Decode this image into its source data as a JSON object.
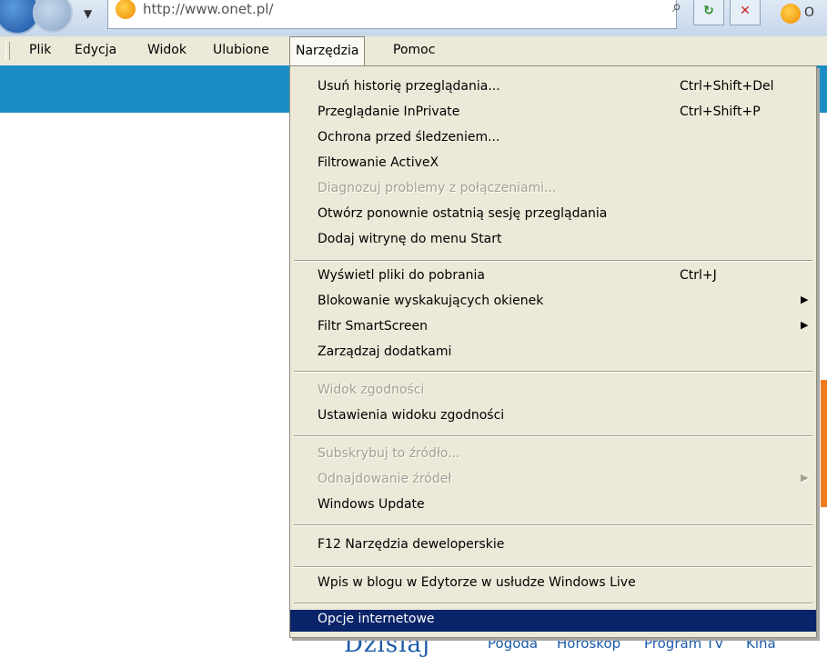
{
  "browser": {
    "url": "http://www.onet.pl/",
    "tab_label": "O"
  },
  "menubar": {
    "items": [
      {
        "label": "Plik"
      },
      {
        "label": "Edycja"
      },
      {
        "label": "Widok"
      },
      {
        "label": "Ulubione"
      },
      {
        "label": "Narzędzia"
      },
      {
        "label": "Pomoc"
      }
    ]
  },
  "tools_menu": {
    "items": [
      {
        "label": "Usuń historię przeglądania...",
        "shortcut": "Ctrl+Shift+Del",
        "enabled": true
      },
      {
        "label": "Przeglądanie InPrivate",
        "shortcut": "Ctrl+Shift+P",
        "enabled": true
      },
      {
        "label": "Ochrona przed śledzeniem...",
        "enabled": true
      },
      {
        "label": "Filtrowanie ActiveX",
        "enabled": true
      },
      {
        "label": "Diagnozuj problemy z połączeniami...",
        "enabled": false
      },
      {
        "label": "Otwórz ponownie ostatnią sesję przeglądania",
        "enabled": true
      },
      {
        "label": "Dodaj witrynę do menu Start",
        "enabled": true
      },
      {
        "label": "Wyświetl pliki do pobrania",
        "shortcut": "Ctrl+J",
        "enabled": true
      },
      {
        "label": "Blokowanie wyskakujących okienek",
        "submenu": true,
        "enabled": true
      },
      {
        "label": "Filtr SmartScreen",
        "submenu": true,
        "enabled": true
      },
      {
        "label": "Zarządzaj dodatkami",
        "enabled": true
      },
      {
        "label": "Widok zgodności",
        "enabled": false
      },
      {
        "label": "Ustawienia widoku zgodności",
        "enabled": true
      },
      {
        "label": "Subskrybuj to źródło...",
        "enabled": false
      },
      {
        "label": "Odnajdowanie źródeł",
        "submenu": true,
        "enabled": false
      },
      {
        "label": "Windows Update",
        "enabled": true
      },
      {
        "label": "F12 Narzędzia deweloperskie",
        "enabled": true
      },
      {
        "label": "Wpis w blogu w Edytorze w usłudze Windows Live",
        "enabled": true
      },
      {
        "label": "Opcje internetowe",
        "enabled": true,
        "highlighted": true
      }
    ]
  },
  "page": {
    "heading": "Dzisiaj",
    "links": [
      "Pogoda",
      "Horoskop",
      "Program TV",
      "Kina"
    ]
  },
  "colors": {
    "highlight": "#0a246a",
    "menu_bg": "#ece9d8",
    "page_band": "#1a8ec4"
  }
}
